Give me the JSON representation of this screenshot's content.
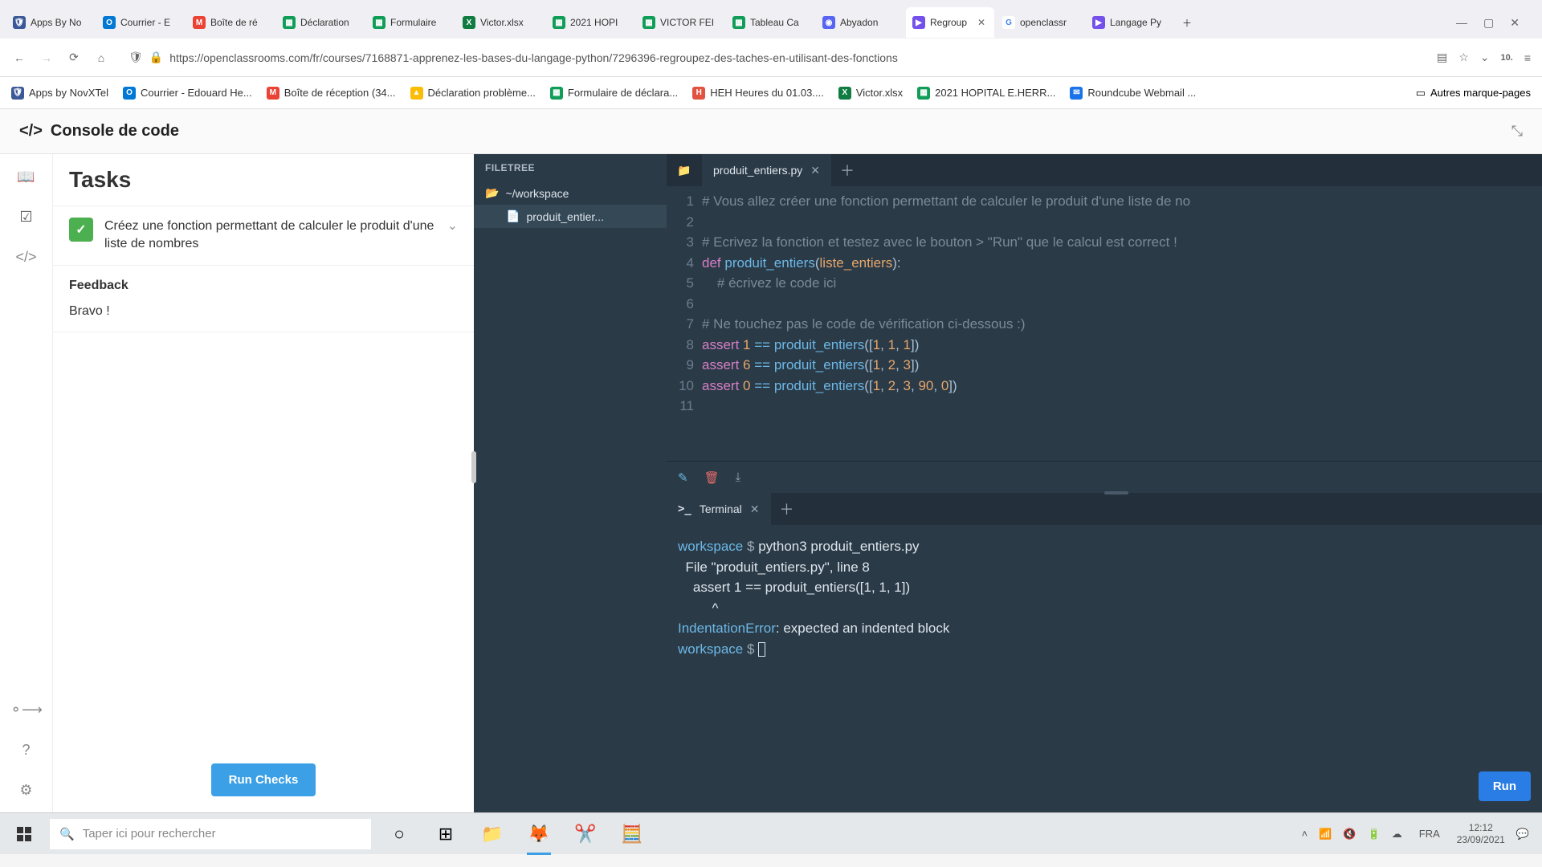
{
  "browser": {
    "tabs": [
      {
        "icon_bg": "#3b5998",
        "icon_txt": "🛡",
        "label": "Apps By No"
      },
      {
        "icon_bg": "#0078d4",
        "icon_txt": "O",
        "label": "Courrier - E"
      },
      {
        "icon_bg": "#ea4335",
        "icon_txt": "M",
        "label": "Boîte de ré"
      },
      {
        "icon_bg": "#0f9d58",
        "icon_txt": "🟩",
        "label": "Déclaration"
      },
      {
        "icon_bg": "#0f9d58",
        "icon_txt": "🟩",
        "label": "Formulaire"
      },
      {
        "icon_bg": "#107c41",
        "icon_txt": "X",
        "label": "Victor.xlsx"
      },
      {
        "icon_bg": "#0f9d58",
        "icon_txt": "🟩",
        "label": "2021 HOPI"
      },
      {
        "icon_bg": "#0f9d58",
        "icon_txt": "🟩",
        "label": "VICTOR FEI"
      },
      {
        "icon_bg": "#0f9d58",
        "icon_txt": "🟩",
        "label": "Tableau Ca"
      },
      {
        "icon_bg": "#5865f2",
        "icon_txt": "◉",
        "label": "Abyadon"
      },
      {
        "icon_bg": "#7451eb",
        "icon_txt": "▶",
        "label": "Regroup"
      },
      {
        "icon_bg": "#4285f4",
        "icon_txt": "G",
        "label": "openclassr"
      },
      {
        "icon_bg": "#7451eb",
        "icon_txt": "▶",
        "label": "Langage Py"
      }
    ],
    "active_tab_index": 10,
    "url": "https://openclassrooms.com/fr/courses/7168871-apprenez-les-bases-du-langage-python/7296396-regroupez-des-taches-en-utilisant-des-fonctions",
    "url_badge": "10."
  },
  "bookmarks": [
    {
      "icon_bg": "#3b5998",
      "label": "Apps by NovXTel"
    },
    {
      "icon_bg": "#0078d4",
      "label": "Courrier - Edouard He..."
    },
    {
      "icon_bg": "#ea4335",
      "label": "Boîte de réception (34..."
    },
    {
      "icon_bg": "#fbbc04",
      "label": "Déclaration problème..."
    },
    {
      "icon_bg": "#0f9d58",
      "label": "Formulaire de déclara..."
    },
    {
      "icon_bg": "#e15241",
      "label": "HEH Heures du 01.03...."
    },
    {
      "icon_bg": "#107c41",
      "label": "Victor.xlsx"
    },
    {
      "icon_bg": "#0f9d58",
      "label": "2021 HOPITAL E.HERR..."
    },
    {
      "icon_bg": "#1a73e8",
      "label": "Roundcube Webmail ..."
    }
  ],
  "bookmarks_right_label": "Autres marque-pages",
  "console_title": "Console de code",
  "tasks": {
    "header": "Tasks",
    "item_text": "Créez une fonction permettant de calculer le produit d'une liste de nombres",
    "feedback_title": "Feedback",
    "feedback_text": "Bravo !",
    "run_checks_label": "Run Checks"
  },
  "filetree": {
    "header": "FILETREE",
    "root": "~/workspace",
    "file": "produit_entier..."
  },
  "editor": {
    "tab_name": "produit_entiers.py",
    "lines": {
      "l1_comment": "# Vous allez créer une fonction permettant de calculer le produit d'une liste de no",
      "l3_comment": "# Ecrivez la fonction et testez avec le bouton > \"Run\" que le calcul est correct !",
      "l4_def": "def",
      "l4_func": "produit_entiers",
      "l4_param": "liste_entiers",
      "l5_comment": "# écrivez le code ici",
      "l7_comment": "# Ne touchez pas le code de vérification ci-dessous :)",
      "assert_kw": "assert",
      "func_call": "produit_entiers"
    },
    "run_label": "Run"
  },
  "terminal": {
    "tab_name": "Terminal",
    "cwd": "workspace",
    "cmd": "python3 produit_entiers.py",
    "err_file": "  File \"produit_entiers.py\", line 8",
    "err_line": "    assert 1 == produit_entiers([1, 1, 1])",
    "err_caret": "         ^",
    "err_type": "IndentationError",
    "err_msg": ": expected an indented block"
  },
  "taskbar": {
    "search_placeholder": "Taper ici pour rechercher",
    "lang": "FRA",
    "time": "12:12",
    "date": "23/09/2021"
  }
}
